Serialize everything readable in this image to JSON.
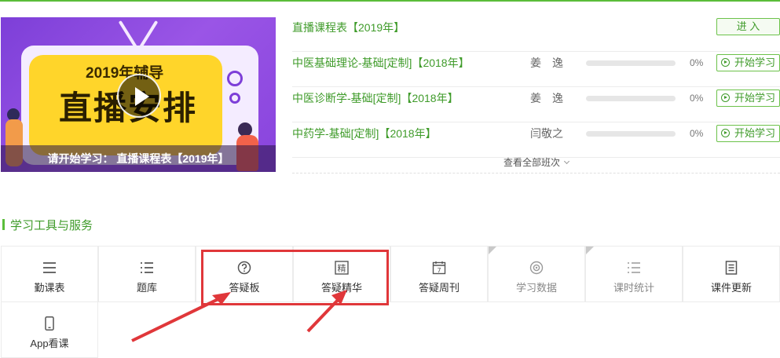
{
  "colors": {
    "accent": "#5bbd3a",
    "link": "#3f9b2a",
    "annotation": "#e0373a"
  },
  "banner": {
    "line1": "2019年辅导",
    "line2": "直播安排",
    "caption": "请开始学习： 直播课程表【2019年】",
    "icons": {
      "play": "play-icon"
    }
  },
  "courses": [
    {
      "title": "直播课程表【2019年】",
      "teacher": "",
      "progress": 0,
      "progress_text": "",
      "button": "进 入"
    },
    {
      "title": "中医基础理论-基础[定制]【2018年】",
      "teacher": "姜　逸",
      "progress": 0,
      "progress_text": "0%",
      "button": "开始学习"
    },
    {
      "title": "中医诊断学-基础[定制]【2018年】",
      "teacher": "姜　逸",
      "progress": 0,
      "progress_text": "0%",
      "button": "开始学习"
    },
    {
      "title": "中药学-基础[定制]【2018年】",
      "teacher": "闫敬之",
      "progress": 0,
      "progress_text": "0%",
      "button": "开始学习"
    }
  ],
  "view_all": "查看全部班次",
  "section": {
    "title": "学习工具与服务"
  },
  "tools": [
    {
      "label": "勤课表",
      "icon": "menu-lines-icon",
      "muted": false,
      "corner": false
    },
    {
      "label": "题库",
      "icon": "list-bullets-icon",
      "muted": false,
      "corner": false
    },
    {
      "label": "答疑板",
      "icon": "question-circle-icon",
      "muted": false,
      "corner": false
    },
    {
      "label": "答疑精华",
      "icon": "essence-char-icon",
      "icon_char": "精",
      "muted": false,
      "corner": false
    },
    {
      "label": "答疑周刊",
      "icon": "calendar-icon",
      "icon_char": "7",
      "muted": false,
      "corner": true
    },
    {
      "label": "学习数据",
      "icon": "target-circle-icon",
      "muted": true,
      "corner": false
    },
    {
      "label": "课时统计",
      "icon": "list-bullets-icon",
      "muted": true,
      "corner": true
    },
    {
      "label": "课件更新",
      "icon": "document-icon",
      "muted": false,
      "corner": false
    },
    {
      "label": "App看课",
      "icon": "phone-icon",
      "muted": false,
      "corner": false
    }
  ]
}
